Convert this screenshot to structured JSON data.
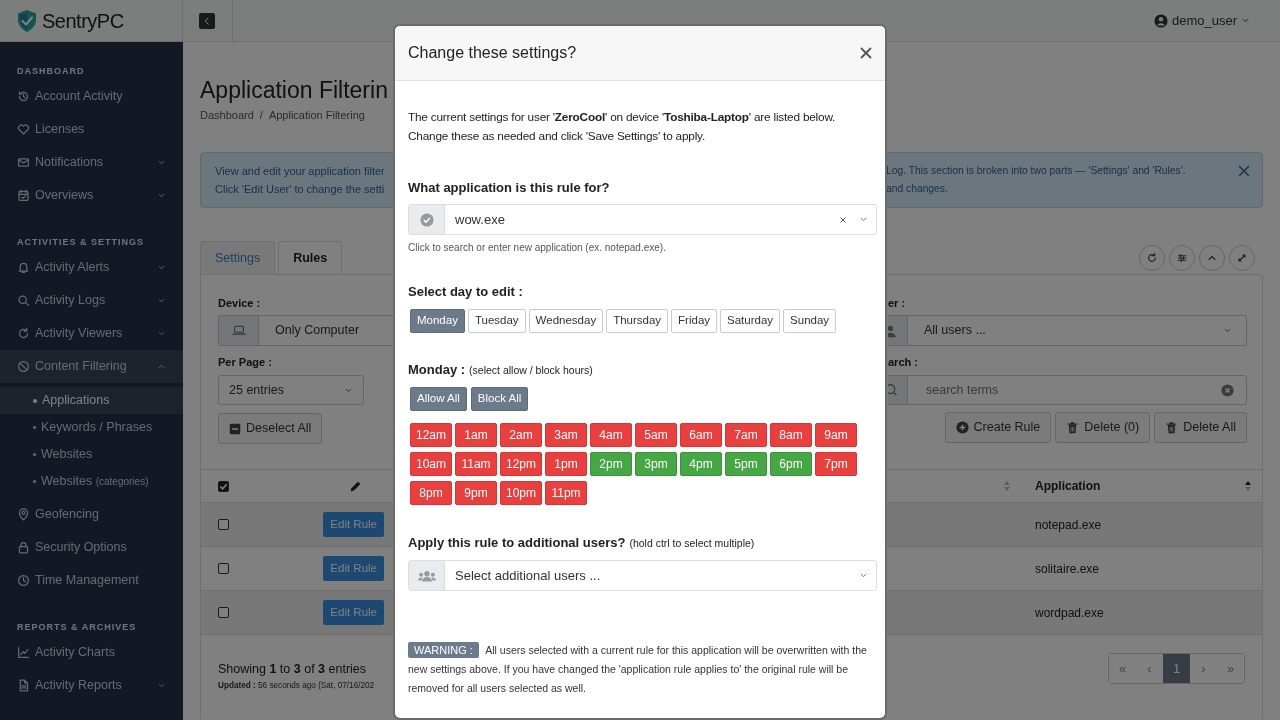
{
  "topbar": {
    "brand": "SentryPC",
    "user": "demo_user"
  },
  "sidebar": {
    "sections": [
      {
        "heading": "DASHBOARD",
        "items": [
          {
            "label": "Account Activity",
            "kind": "link",
            "selected": false
          },
          {
            "label": "Licenses",
            "kind": "link",
            "selected": false
          },
          {
            "label": "Notifications",
            "kind": "group",
            "expanded": false,
            "selected": false
          },
          {
            "label": "Overviews",
            "kind": "group",
            "expanded": false,
            "selected": false
          }
        ]
      },
      {
        "heading": "ACTIVITIES & SETTINGS",
        "items": [
          {
            "label": "Activity Alerts",
            "kind": "group",
            "expanded": false,
            "selected": false
          },
          {
            "label": "Activity Logs",
            "kind": "group",
            "expanded": false,
            "selected": false
          },
          {
            "label": "Activity Viewers",
            "kind": "group",
            "expanded": false,
            "selected": false
          },
          {
            "label": "Content Filtering",
            "kind": "group",
            "expanded": true,
            "selected": true,
            "children": [
              {
                "label": "Applications",
                "selected": true
              },
              {
                "label": "Keywords / Phrases",
                "selected": false
              },
              {
                "label": "Websites",
                "selected": false
              },
              {
                "label": "Websites",
                "note": "(categories)",
                "selected": false
              }
            ]
          },
          {
            "label": "Geofencing",
            "kind": "link",
            "selected": false
          },
          {
            "label": "Security Options",
            "kind": "link",
            "selected": false
          },
          {
            "label": "Time Management",
            "kind": "link",
            "selected": false
          }
        ]
      },
      {
        "heading": "REPORTS & ARCHIVES",
        "items": [
          {
            "label": "Activity Charts",
            "kind": "link",
            "selected": false
          },
          {
            "label": "Activity Reports",
            "kind": "group",
            "expanded": false,
            "selected": false
          }
        ]
      }
    ]
  },
  "page": {
    "title": "Application Filterin",
    "breadcrumb": [
      "Dashboard",
      "Application Filtering"
    ],
    "breadcrumb_separator": "/",
    "alert": {
      "left_lines": [
        "View and edit your application filter",
        "Click 'Edit User' to change the setti"
      ],
      "right_lines": [
        "Log. This section is broken into two parts — 'Settings' and 'Rules'.",
        "and changes."
      ]
    },
    "tabs": [
      {
        "label": "Settings",
        "selected": false
      },
      {
        "label": "Rules",
        "selected": true
      }
    ],
    "filters": {
      "device_label": "Device :",
      "device_value": "Only Computer",
      "per_page_label": "Per Page :",
      "per_page_value": "25 entries",
      "deselect": "Deselect All",
      "user_label": "er :",
      "user_value": "All users ...",
      "search_label": "arch :",
      "search_placeholder": "search terms"
    },
    "actions": [
      "Create Rule",
      "Delete (0)",
      "Delete All"
    ],
    "table": {
      "header_checked": true,
      "application_column": "Application",
      "rows": [
        {
          "checked": false,
          "button": "Edit Rule",
          "application": "notepad.exe"
        },
        {
          "checked": false,
          "button": "Edit Rule",
          "application": "solitaire.exe"
        },
        {
          "checked": false,
          "button": "Edit Rule",
          "application": "wordpad.exe"
        }
      ]
    },
    "footer": {
      "showing": "Showing **1** to **3** of **3** entries",
      "updated": "**Updated :** 56 seconds ago (Sat, 07/16/202"
    },
    "pagination": [
      {
        "label": "«",
        "selected": false
      },
      {
        "label": "‹",
        "selected": false
      },
      {
        "label": "1",
        "selected": true
      },
      {
        "label": "›",
        "selected": false
      },
      {
        "label": "»",
        "selected": false
      }
    ]
  },
  "modal": {
    "title": "Change these settings?",
    "intro_lines": [
      "The current settings for user '**ZeroCool**' on device '**Toshiba-Laptop**' are listed below.",
      "Change these as needed and click 'Save Settings' to apply."
    ],
    "app_label": "What application is this rule for?",
    "app_value": "wow.exe",
    "app_help": "Click to search or enter new application (ex. notepad.exe).",
    "day_label": "Select day to edit :",
    "days": [
      {
        "label": "Monday",
        "selected": true
      },
      {
        "label": "Tuesday",
        "selected": false
      },
      {
        "label": "Wednesday",
        "selected": false
      },
      {
        "label": "Thursday",
        "selected": false
      },
      {
        "label": "Friday",
        "selected": false
      },
      {
        "label": "Saturday",
        "selected": false
      },
      {
        "label": "Sunday",
        "selected": false
      }
    ],
    "hours_label": "Monday :",
    "hours_hint": "(select allow / block hours)",
    "bulk_buttons": [
      "Allow All",
      "Block All"
    ],
    "hours": [
      {
        "label": "12am",
        "allowed": false
      },
      {
        "label": "1am",
        "allowed": false
      },
      {
        "label": "2am",
        "allowed": false
      },
      {
        "label": "3am",
        "allowed": false
      },
      {
        "label": "4am",
        "allowed": false
      },
      {
        "label": "5am",
        "allowed": false
      },
      {
        "label": "6am",
        "allowed": false
      },
      {
        "label": "7am",
        "allowed": false
      },
      {
        "label": "8am",
        "allowed": false
      },
      {
        "label": "9am",
        "allowed": false
      },
      {
        "label": "10am",
        "allowed": false
      },
      {
        "label": "11am",
        "allowed": false
      },
      {
        "label": "12pm",
        "allowed": false
      },
      {
        "label": "1pm",
        "allowed": false
      },
      {
        "label": "2pm",
        "allowed": true
      },
      {
        "label": "3pm",
        "allowed": true
      },
      {
        "label": "4pm",
        "allowed": true
      },
      {
        "label": "5pm",
        "allowed": true
      },
      {
        "label": "6pm",
        "allowed": true
      },
      {
        "label": "7pm",
        "allowed": false
      },
      {
        "label": "8pm",
        "allowed": false
      },
      {
        "label": "9pm",
        "allowed": false
      },
      {
        "label": "10pm",
        "allowed": false
      },
      {
        "label": "11pm",
        "allowed": false
      }
    ],
    "users_label": "Apply this rule to additional users?",
    "users_hint": "(hold ctrl to select multiple)",
    "users_placeholder": "Select additional users ...",
    "warning_badge": "WARNING :",
    "warning": "All users selected with a current rule for this application will be overwritten with the new settings above. If you have changed the 'application rule applies to' the original rule will be removed for all users selected as well."
  }
}
